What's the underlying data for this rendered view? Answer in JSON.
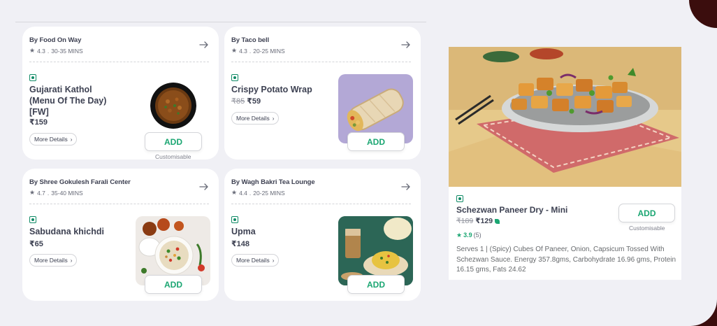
{
  "cards": [
    {
      "restaurant": "By Food On Way",
      "rating": "4.3",
      "eta": "30-35 MINS",
      "dish": "Gujarati Kathol (Menu Of The Day) [FW]",
      "price": "₹159",
      "more": "More Details",
      "add": "ADD",
      "customisable": "Customisable"
    },
    {
      "restaurant": "By Taco bell",
      "rating": "4.3",
      "eta": "20-25 MINS",
      "dish": "Crispy Potato Wrap",
      "old_price": "₹85",
      "price": "₹59",
      "more": "More Details",
      "add": "ADD"
    },
    {
      "restaurant": "By Shree Gokulesh Farali Center",
      "rating": "4.7",
      "eta": "35-40 MINS",
      "dish": "Sabudana khichdi",
      "price": "₹65",
      "more": "More Details",
      "add": "ADD"
    },
    {
      "restaurant": "By Wagh Bakri Tea Lounge",
      "rating": "4.4",
      "eta": "20-25 MINS",
      "dish": "Upma",
      "price": "₹148",
      "more": "More Details",
      "add": "ADD"
    }
  ],
  "detail": {
    "dish": "Schezwan Paneer Dry - Mini",
    "old_price": "₹189",
    "price": "₹129",
    "rating": "3.9",
    "rating_count": "(5)",
    "add": "ADD",
    "customisable": "Customisable",
    "description": "Serves 1 | (Spicy) Cubes Of Paneer, Onion, Capsicum Tossed With Schezwan Sauce. Energy 357.8gms, Carbohydrate 16.96 gms, Protein 16.15 gms, Fats 24.62"
  },
  "colors": {
    "accent_green": "#1ba672",
    "veg_green": "#0f8a65",
    "outer_frame": "#3b0d0d",
    "page_bg": "#f0f0f5"
  },
  "icons": {
    "star": "star-icon",
    "arrow": "arrow-right-icon",
    "veg": "veg-indicator-icon",
    "chevron": "chevron-right-icon"
  }
}
